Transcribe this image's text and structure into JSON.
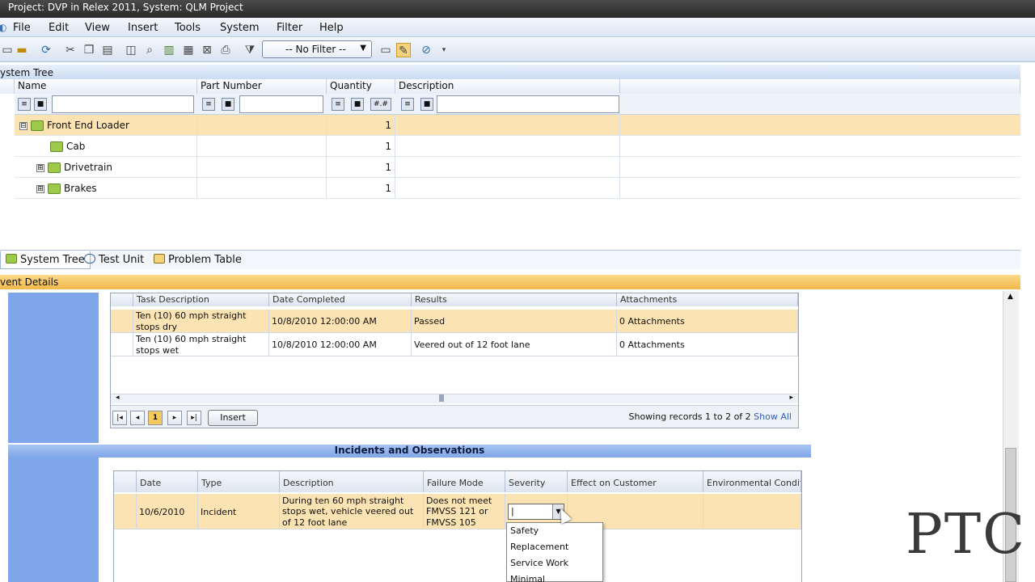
{
  "window": {
    "title": "Project: DVP in Relex 2011, System: QLM Project"
  },
  "menu": [
    "File",
    "Edit",
    "View",
    "Insert",
    "Tools",
    "System",
    "Filter",
    "Help"
  ],
  "toolbar": {
    "filter_value": "-- No Filter --",
    "icons": [
      "open-icon",
      "save-icon",
      "refresh-icon",
      "cut-icon",
      "copy-icon",
      "paste-icon",
      "preview-icon",
      "find-icon",
      "chart-icon",
      "calculator-icon",
      "export-icon",
      "print-icon",
      "filter-icon",
      "view-icon",
      "highlight-icon",
      "help-icon"
    ]
  },
  "system_tree": {
    "header": "ystem Tree",
    "columns": [
      "Name",
      "Part Number",
      "Quantity",
      "Description"
    ],
    "rows": [
      {
        "name": "Front End Loader",
        "expander": "⊟",
        "quantity": "1"
      },
      {
        "name": "Cab",
        "expander": "",
        "quantity": "1"
      },
      {
        "name": "Drivetrain",
        "expander": "⊞",
        "quantity": "1"
      },
      {
        "name": "Brakes",
        "expander": "⊞",
        "quantity": "1"
      }
    ]
  },
  "tabs": [
    "System Tree",
    "Test Unit",
    "Problem Table"
  ],
  "event_details": {
    "header": "vent Details",
    "tasks": {
      "columns": [
        "Task Description",
        "Date Completed",
        "Results",
        "Attachments"
      ],
      "rows": [
        {
          "task": "Ten (10) 60 mph straight stops dry",
          "date": "10/8/2010 12:00:00 AM",
          "result": "Passed",
          "attachments": "0 Attachments"
        },
        {
          "task": "Ten (10) 60 mph straight stops wet",
          "date": "10/8/2010 12:00:00 AM",
          "result": "Veered out of 12 foot lane",
          "attachments": "0 Attachments"
        }
      ],
      "page": "1",
      "insert_label": "Insert",
      "records_text": "Showing records 1 to 2 of 2",
      "show_all": "Show All"
    },
    "incidents": {
      "title": "Incidents and Observations",
      "columns": [
        "Date",
        "Type",
        "Description",
        "Failure Mode",
        "Severity",
        "Effect on Customer",
        "Environmental Conditi"
      ],
      "row": {
        "date": "10/6/2010",
        "type": "Incident",
        "description": "During ten 60 mph straight stops wet, vehicle veered out of 12 foot lane",
        "failure_mode": "Does not meet FMVSS 121 or FMVSS 105",
        "severity": "|"
      },
      "severity_options": [
        "Safety",
        "Replacement",
        "Service Work",
        "Minimal"
      ]
    }
  },
  "watermark": "PTC"
}
